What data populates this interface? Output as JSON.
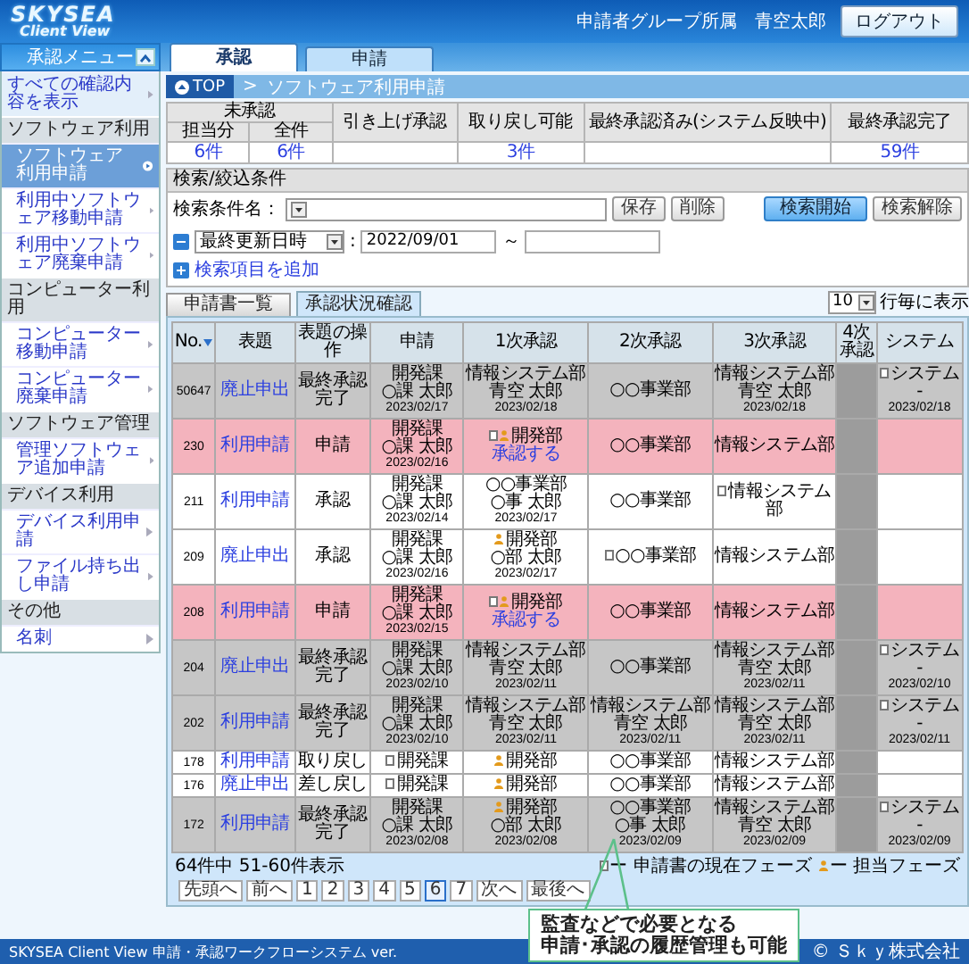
{
  "header": {
    "logo_top": "SKYSEA",
    "logo_bottom": "Client View",
    "user": "申請者グループ所属　青空太郎",
    "logout_button": "ログアウト"
  },
  "sidebar": {
    "title": "承認メニュー",
    "items": [
      {
        "kind": "link",
        "label": "すべての確認内容を表示",
        "selected": false
      },
      {
        "kind": "group",
        "label": "ソフトウェア利用",
        "children": [
          {
            "label": "ソフトウェア利用申請",
            "selected": true
          },
          {
            "label": "利用中ソフトウェア移動申請",
            "selected": false
          },
          {
            "label": "利用中ソフトウェア廃棄申請",
            "selected": false
          }
        ]
      },
      {
        "kind": "group",
        "label": "コンピューター利用",
        "children": [
          {
            "label": "コンピューター移動申請",
            "selected": false
          },
          {
            "label": "コンピューター廃棄申請",
            "selected": false
          }
        ]
      },
      {
        "kind": "group",
        "label": "ソフトウェア管理",
        "children": [
          {
            "label": "管理ソフトウェア追加申請",
            "selected": false
          }
        ]
      },
      {
        "kind": "group",
        "label": "デバイス利用",
        "children": [
          {
            "label": "デバイス利用申請",
            "selected": false
          },
          {
            "label": "ファイル持ち出し申請",
            "selected": false
          }
        ]
      },
      {
        "kind": "group",
        "label": "その他",
        "children": [
          {
            "label": "名刺",
            "selected": false
          }
        ]
      }
    ]
  },
  "tabs": [
    {
      "label": "承認",
      "selected": true
    },
    {
      "label": "申請",
      "selected": false
    }
  ],
  "breadcrumb": {
    "home": "TOP",
    "separator": ">",
    "current": "ソフトウェア利用申請"
  },
  "summary": {
    "group_label": "未承認",
    "group_columns": [
      {
        "label": "担当分",
        "count": "6件"
      },
      {
        "label": "全件",
        "count": "6件"
      }
    ],
    "columns": [
      {
        "label": "引き上げ承認"
      },
      {
        "label": "取り戻し可能",
        "count": "3件"
      },
      {
        "label": "最終承認済み(システム反映中)"
      },
      {
        "label": "最終承認完了",
        "count": "59件"
      }
    ]
  },
  "search": {
    "title": "検索/絞込条件",
    "condition_label": "検索条件名：",
    "save_button": "保存",
    "delete_button": "削除",
    "start_button": "検索開始",
    "clear_button": "検索解除",
    "filters": [
      {
        "field": "最終更新日時",
        "separator": ":",
        "from": "2022/09/01",
        "range_mark": "～"
      }
    ],
    "add_filter": "検索項目を追加"
  },
  "subtabs": [
    {
      "label": "申請書一覧",
      "selected": false
    },
    {
      "label": "承認状況確認",
      "selected": true
    }
  ],
  "page_size": {
    "value": "10",
    "label": "行毎に表示"
  },
  "status_table": {
    "columns": [
      {
        "label": "No.",
        "sorted": true,
        "unused": false
      },
      {
        "label": "表題",
        "sorted": false,
        "unused": false
      },
      {
        "label": "表題の操作",
        "sorted": false,
        "unused": false
      },
      {
        "label": "申請",
        "sorted": false,
        "unused": false
      },
      {
        "label": "1次承認",
        "sorted": false,
        "unused": false
      },
      {
        "label": "2次承認",
        "sorted": false,
        "unused": false
      },
      {
        "label": "3次承認",
        "sorted": false,
        "unused": false
      },
      {
        "label": "4次承認",
        "sorted": false,
        "unused": true
      },
      {
        "label": "システム",
        "sorted": false,
        "unused": false
      }
    ],
    "rows": [
      {
        "kind": "completed",
        "no": "50647",
        "title": "廃止申出",
        "action": "最終承認完了",
        "steps": [
          {
            "unit": "開発課",
            "person": "○課 太郎",
            "date": "2023/02/17",
            "current": false,
            "assignee": false
          },
          {
            "unit": "情報システム部",
            "person": "青空 太郎",
            "date": "2023/02/18",
            "current": false,
            "assignee": false
          },
          {
            "unit": "○○事業部",
            "current": false,
            "assignee": false
          },
          {
            "unit": "情報システム部",
            "person": "青空 太郎",
            "date": "2023/02/18",
            "current": false,
            "assignee": false
          },
          {
            "current": false,
            "assignee": false
          },
          {
            "unit": "システム",
            "person": "-",
            "date": "2023/02/18",
            "current": true,
            "assignee": false
          }
        ]
      },
      {
        "kind": "pending",
        "no": "230",
        "title": "利用申請",
        "action": "申請",
        "steps": [
          {
            "unit": "開発課",
            "person": "○課 太郎",
            "date": "2023/02/16",
            "current": false,
            "assignee": false
          },
          {
            "unit": "開発部",
            "link": "承認する",
            "current": true,
            "assignee": true
          },
          {
            "unit": "○○事業部",
            "current": false,
            "assignee": false
          },
          {
            "unit": "情報システム部",
            "current": false,
            "assignee": false
          },
          {
            "current": false,
            "assignee": false
          },
          {
            "current": false,
            "assignee": false
          }
        ]
      },
      {
        "kind": "open",
        "no": "211",
        "title": "利用申請",
        "action": "承認",
        "steps": [
          {
            "unit": "開発課",
            "person": "○課 太郎",
            "date": "2023/02/14",
            "current": false,
            "assignee": false
          },
          {
            "unit": "○○事業部",
            "person": "○事 太郎",
            "date": "2023/02/17",
            "current": false,
            "assignee": false
          },
          {
            "unit": "○○事業部",
            "current": false,
            "assignee": false
          },
          {
            "unit": "情報システム部",
            "current": true,
            "assignee": false
          },
          {
            "current": false,
            "assignee": false
          },
          {
            "current": false,
            "assignee": false
          }
        ]
      },
      {
        "kind": "open",
        "no": "209",
        "title": "廃止申出",
        "action": "承認",
        "steps": [
          {
            "unit": "開発課",
            "person": "○課 太郎",
            "date": "2023/02/16",
            "current": false,
            "assignee": false
          },
          {
            "unit": "開発部",
            "person": "○部 太郎",
            "date": "2023/02/17",
            "current": false,
            "assignee": true
          },
          {
            "unit": "○○事業部",
            "current": true,
            "assignee": false
          },
          {
            "unit": "情報システム部",
            "current": false,
            "assignee": false
          },
          {
            "current": false,
            "assignee": false
          },
          {
            "current": false,
            "assignee": false
          }
        ]
      },
      {
        "kind": "pending",
        "no": "208",
        "title": "利用申請",
        "action": "申請",
        "steps": [
          {
            "unit": "開発課",
            "person": "○課 太郎",
            "date": "2023/02/15",
            "current": false,
            "assignee": false
          },
          {
            "unit": "開発部",
            "link": "承認する",
            "current": true,
            "assignee": true
          },
          {
            "unit": "○○事業部",
            "current": false,
            "assignee": false
          },
          {
            "unit": "情報システム部",
            "current": false,
            "assignee": false
          },
          {
            "current": false,
            "assignee": false
          },
          {
            "current": false,
            "assignee": false
          }
        ]
      },
      {
        "kind": "completed",
        "no": "204",
        "title": "廃止申出",
        "action": "最終承認完了",
        "steps": [
          {
            "unit": "開発課",
            "person": "○課 太郎",
            "date": "2023/02/10",
            "current": false,
            "assignee": false
          },
          {
            "unit": "情報システム部",
            "person": "青空 太郎",
            "date": "2023/02/11",
            "current": false,
            "assignee": false
          },
          {
            "unit": "○○事業部",
            "current": false,
            "assignee": false
          },
          {
            "unit": "情報システム部",
            "person": "青空 太郎",
            "date": "2023/02/11",
            "current": false,
            "assignee": false
          },
          {
            "current": false,
            "assignee": false
          },
          {
            "unit": "システム",
            "person": "-",
            "date": "2023/02/10",
            "current": true,
            "assignee": false
          }
        ]
      },
      {
        "kind": "completed",
        "no": "202",
        "title": "利用申請",
        "action": "最終承認完了",
        "steps": [
          {
            "unit": "開発課",
            "person": "○課 太郎",
            "date": "2023/02/10",
            "current": false,
            "assignee": false
          },
          {
            "unit": "情報システム部",
            "person": "青空 太郎",
            "date": "2023/02/11",
            "current": false,
            "assignee": false
          },
          {
            "unit": "情報システム部",
            "person": "青空 太郎",
            "date": "2023/02/11",
            "current": false,
            "assignee": false
          },
          {
            "unit": "情報システム部",
            "person": "青空 太郎",
            "date": "2023/02/11",
            "current": false,
            "assignee": false
          },
          {
            "current": false,
            "assignee": false
          },
          {
            "unit": "システム",
            "person": "-",
            "date": "2023/02/11",
            "current": true,
            "assignee": false
          }
        ]
      },
      {
        "kind": "open",
        "no": "178",
        "title": "利用申請",
        "action": "取り戻し",
        "steps": [
          {
            "unit": "開発課",
            "current": true,
            "assignee": false
          },
          {
            "unit": "開発部",
            "current": false,
            "assignee": true
          },
          {
            "unit": "○○事業部",
            "current": false,
            "assignee": false
          },
          {
            "unit": "情報システム部",
            "current": false,
            "assignee": false
          },
          {
            "current": false,
            "assignee": false
          },
          {
            "current": false,
            "assignee": false
          }
        ]
      },
      {
        "kind": "open",
        "no": "176",
        "title": "廃止申出",
        "action": "差し戻し",
        "steps": [
          {
            "unit": "開発課",
            "current": true,
            "assignee": false
          },
          {
            "unit": "開発部",
            "current": false,
            "assignee": true
          },
          {
            "unit": "○○事業部",
            "current": false,
            "assignee": false
          },
          {
            "unit": "情報システム部",
            "current": false,
            "assignee": false
          },
          {
            "current": false,
            "assignee": false
          },
          {
            "current": false,
            "assignee": false
          }
        ]
      },
      {
        "kind": "completed",
        "no": "172",
        "title": "利用申請",
        "action": "最終承認完了",
        "steps": [
          {
            "unit": "開発課",
            "person": "○課 太郎",
            "date": "2023/02/08",
            "current": false,
            "assignee": false
          },
          {
            "unit": "開発部",
            "person": "○部 太郎",
            "date": "2023/02/08",
            "current": false,
            "assignee": true
          },
          {
            "unit": "○○事業部",
            "person": "○事 太郎",
            "date": "2023/02/09",
            "current": false,
            "assignee": false
          },
          {
            "unit": "情報システム部",
            "person": "青空 太郎",
            "date": "2023/02/09",
            "current": false,
            "assignee": false
          },
          {
            "current": false,
            "assignee": false
          },
          {
            "unit": "システム",
            "person": "-",
            "date": "2023/02/09",
            "current": true,
            "assignee": false
          }
        ]
      }
    ]
  },
  "pagination": {
    "summary": "64件中 51-60件表示",
    "first": "先頭へ",
    "prev": "前へ",
    "pages": [
      {
        "label": "1",
        "selected": false
      },
      {
        "label": "2",
        "selected": false
      },
      {
        "label": "3",
        "selected": false
      },
      {
        "label": "4",
        "selected": false
      },
      {
        "label": "5",
        "selected": false
      },
      {
        "label": "6",
        "selected": true
      },
      {
        "label": "7",
        "selected": false
      }
    ],
    "next": "次へ",
    "last": "最後へ"
  },
  "legend": [
    {
      "kind": "current",
      "label": "ー 申請書の現在フェーズ"
    },
    {
      "kind": "assignee",
      "label": "ー 担当フェーズ"
    }
  ],
  "footer": {
    "product": "SKYSEA Client View 申請・承認ワークフローシステム ver.",
    "copyright": "© Ｓｋｙ株式会社"
  },
  "callout": {
    "lines": [
      "監査などで必要となる",
      "申請･承認の履歴管理も可能"
    ]
  }
}
